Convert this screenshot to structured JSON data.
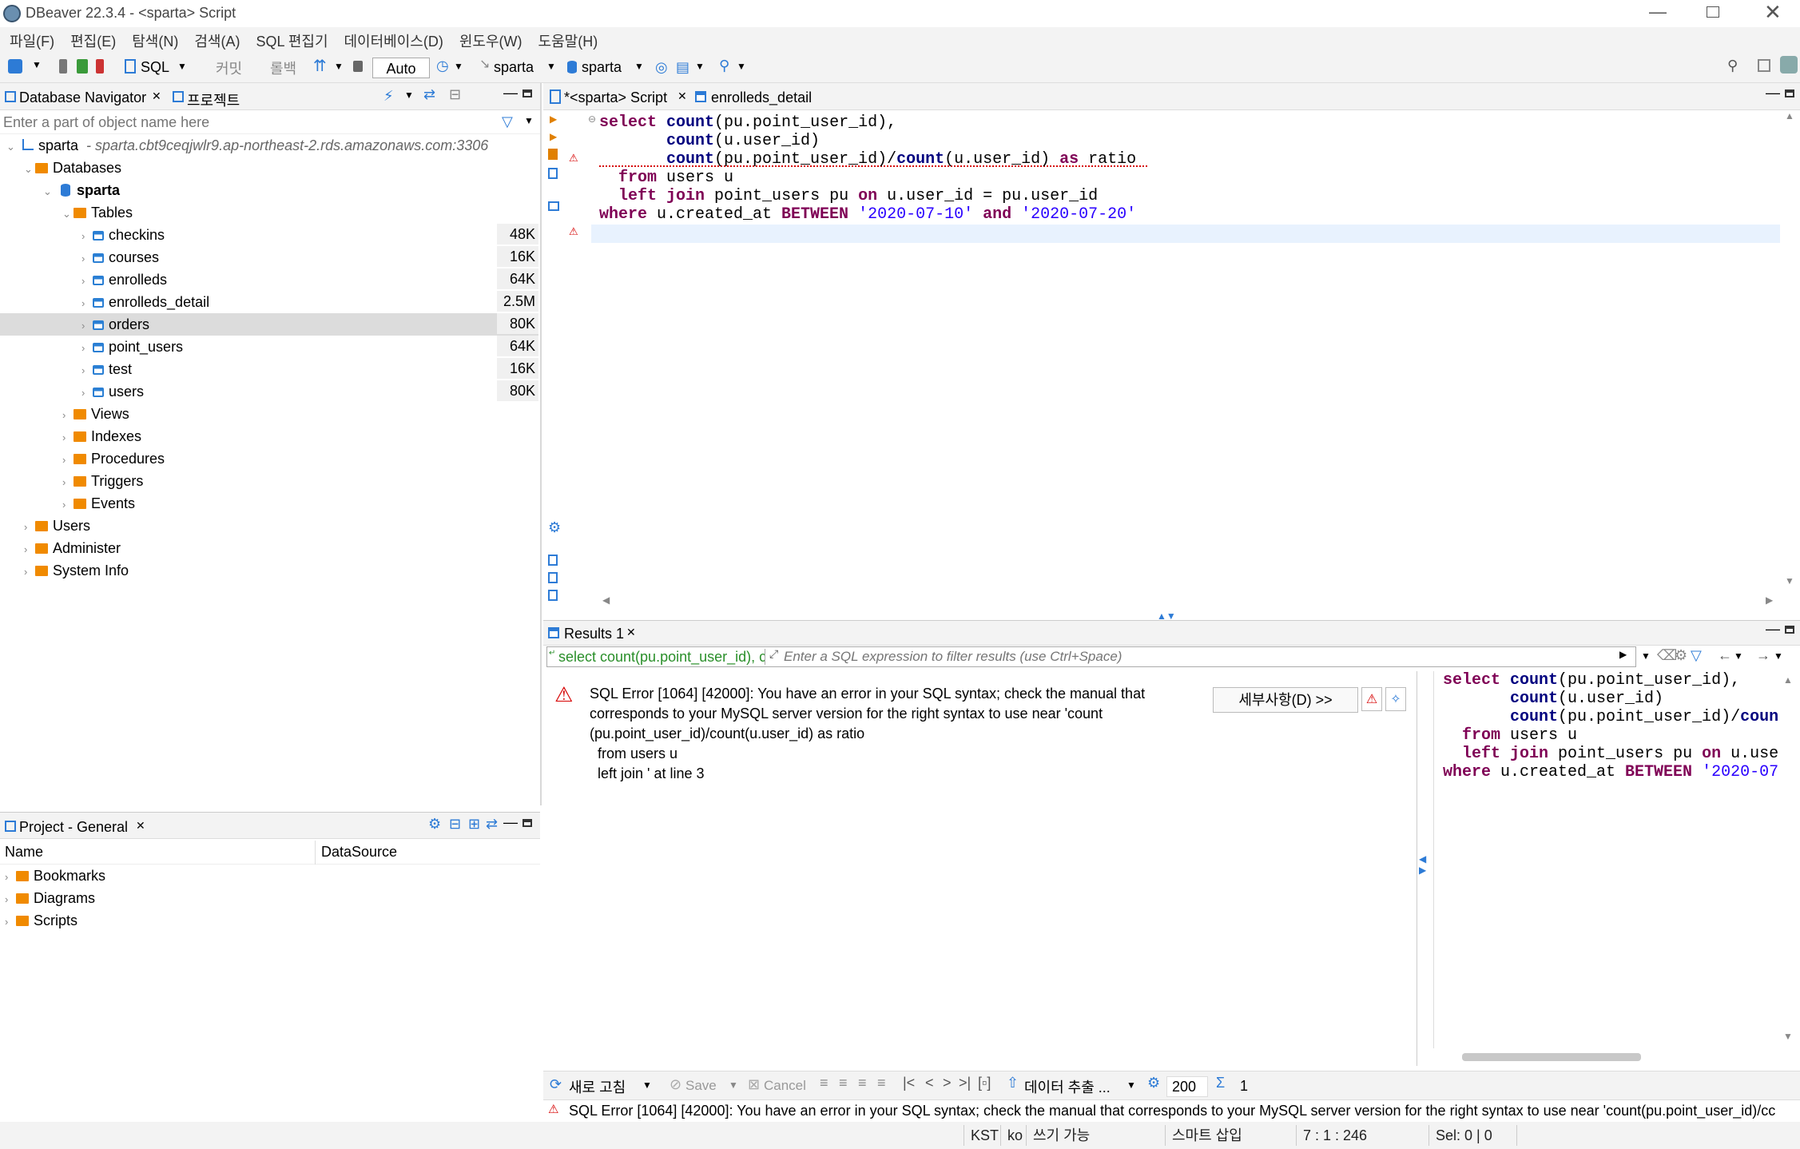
{
  "window": {
    "title": "DBeaver 22.3.4 - <sparta> Script"
  },
  "menu": [
    "파일(F)",
    "편집(E)",
    "탐색(N)",
    "검색(A)",
    "SQL 편집기",
    "데이터베이스(D)",
    "윈도우(W)",
    "도움말(H)"
  ],
  "toolbar": {
    "sql_label": "SQL",
    "commit_label": "커밋",
    "rollback_label": "롤백",
    "auto_label": "Auto",
    "datasource_label": "sparta",
    "schema_label": "sparta"
  },
  "navigator": {
    "tab_label": "Database Navigator",
    "project_tab_label": "프로젝트",
    "filter_placeholder": "Enter a part of object name here",
    "connection": {
      "name": "sparta",
      "host": "- sparta.cbt9ceqjwlr9.ap-northeast-2.rds.amazonaws.com:3306"
    },
    "databases_label": "Databases",
    "db_name": "sparta",
    "tables_label": "Tables",
    "tables": [
      {
        "name": "checkins",
        "size": "48K"
      },
      {
        "name": "courses",
        "size": "16K"
      },
      {
        "name": "enrolleds",
        "size": "64K"
      },
      {
        "name": "enrolleds_detail",
        "size": "2.5M"
      },
      {
        "name": "orders",
        "size": "80K"
      },
      {
        "name": "point_users",
        "size": "64K"
      },
      {
        "name": "test",
        "size": "16K"
      },
      {
        "name": "users",
        "size": "80K"
      }
    ],
    "folders": [
      "Views",
      "Indexes",
      "Procedures",
      "Triggers",
      "Events"
    ],
    "root_items": [
      "Users",
      "Administer",
      "System Info"
    ]
  },
  "project": {
    "tab_label": "Project - General",
    "col_name": "Name",
    "col_datasource": "DataSource",
    "items": [
      "Bookmarks",
      "Diagrams",
      "Scripts"
    ]
  },
  "editor": {
    "tabs": [
      {
        "label": "*<sparta> Script"
      },
      {
        "label": "enrolleds_detail"
      }
    ],
    "code": [
      {
        "parts": [
          [
            "kw",
            "select"
          ],
          [
            "t",
            " "
          ],
          [
            "fn",
            "count"
          ],
          [
            "t",
            "(pu.point_user_id),"
          ]
        ]
      },
      {
        "parts": [
          [
            "t",
            "       "
          ],
          [
            "fn",
            "count"
          ],
          [
            "t",
            "(u.user_id)"
          ]
        ]
      },
      {
        "parts": [
          [
            "t",
            "       "
          ],
          [
            "fn",
            "count"
          ],
          [
            "t",
            "(pu.point_user_id)/"
          ],
          [
            "fn",
            "count"
          ],
          [
            "t",
            "(u.user_id) "
          ],
          [
            "kw",
            "as"
          ],
          [
            "t",
            " ratio"
          ]
        ]
      },
      {
        "parts": [
          [
            "t",
            "  "
          ],
          [
            "kw",
            "from"
          ],
          [
            "t",
            " users u"
          ]
        ]
      },
      {
        "parts": [
          [
            "t",
            "  "
          ],
          [
            "kw",
            "left join"
          ],
          [
            "t",
            " point_users pu "
          ],
          [
            "kw",
            "on"
          ],
          [
            "t",
            " u.user_id = pu.user_id"
          ]
        ]
      },
      {
        "parts": [
          [
            "kw",
            "where"
          ],
          [
            "t",
            " u.created_at "
          ],
          [
            "kw",
            "BETWEEN"
          ],
          [
            "t",
            " "
          ],
          [
            "str",
            "'2020-07-10'"
          ],
          [
            "t",
            " "
          ],
          [
            "kw",
            "and"
          ],
          [
            "t",
            " "
          ],
          [
            "str",
            "'2020-07-20'"
          ]
        ]
      }
    ]
  },
  "results": {
    "tab_label": "Results 1",
    "query_preview": "select count(pu.point_user_id), count(u.user_i",
    "filter_placeholder": "Enter a SQL expression to filter results (use Ctrl+Space)",
    "error_lines": [
      "SQL Error [1064] [42000]: You have an error in your SQL syntax; check the manual that",
      "corresponds to your MySQL server version for the right syntax to use near 'count",
      "(pu.point_user_id)/count(u.user_id) as ratio",
      "  from users u",
      "  left join ' at line 3"
    ],
    "details_button": "세부사항(D) >>",
    "side_code": [
      {
        "parts": [
          [
            "kw",
            "select"
          ],
          [
            "t",
            " "
          ],
          [
            "fn",
            "count"
          ],
          [
            "t",
            "(pu.point_user_id),"
          ]
        ]
      },
      {
        "parts": [
          [
            "t",
            "       "
          ],
          [
            "fn",
            "count"
          ],
          [
            "t",
            "(u.user_id)"
          ]
        ]
      },
      {
        "parts": [
          [
            "t",
            "       "
          ],
          [
            "fn",
            "count"
          ],
          [
            "t",
            "(pu.point_user_id)/"
          ],
          [
            "fn",
            "coun"
          ]
        ]
      },
      {
        "parts": [
          [
            "t",
            "  "
          ],
          [
            "kw",
            "from"
          ],
          [
            "t",
            " users u"
          ]
        ]
      },
      {
        "parts": [
          [
            "t",
            "  "
          ],
          [
            "kw",
            "left join"
          ],
          [
            "t",
            " point_users pu "
          ],
          [
            "kw",
            "on"
          ],
          [
            "t",
            " u.use"
          ]
        ]
      },
      {
        "parts": [
          [
            "kw",
            "where"
          ],
          [
            "t",
            " u.created_at "
          ],
          [
            "kw",
            "BETWEEN"
          ],
          [
            "t",
            " "
          ],
          [
            "str",
            "'2020-07"
          ]
        ]
      }
    ],
    "bottom": {
      "refresh_label": "새로 고침",
      "save_label": "Save",
      "cancel_label": "Cancel",
      "export_label": "데이터 추출 ...",
      "fetch_size": "200",
      "row_count": "1"
    },
    "error_status": "SQL Error [1064] [42000]: You have an error in your SQL syntax; check the manual that corresponds to your MySQL server version for the right syntax to use near 'count(pu.point_user_id)/cc"
  },
  "statusbar": {
    "tz": "KST",
    "lang": "ko",
    "mode": "쓰기 가능",
    "insert": "스마트 삽입",
    "pos": "7 : 1 : 246",
    "sel": "Sel: 0 | 0"
  },
  "colors": {
    "keyword": "#7f0055",
    "function": "#00007f",
    "string": "#2a00ff",
    "error": "#d60000",
    "selected_row": "#dcdcdc"
  }
}
